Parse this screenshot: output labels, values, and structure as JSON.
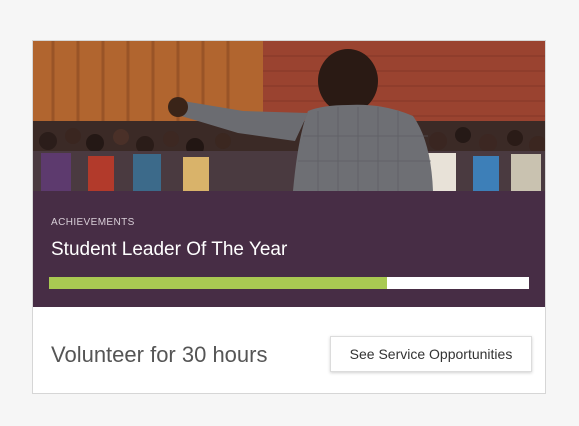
{
  "card": {
    "category": "ACHIEVEMENTS",
    "title": "Student Leader Of The Year",
    "progress_fraction": 0.705,
    "goal_text": "Volunteer for 30 hours",
    "cta_label": "See Service Opportunities"
  },
  "colors": {
    "band": "#472d45",
    "progress_fill": "#a9c952",
    "progress_track": "#ffffff",
    "page_background": "#f6f6f6"
  }
}
